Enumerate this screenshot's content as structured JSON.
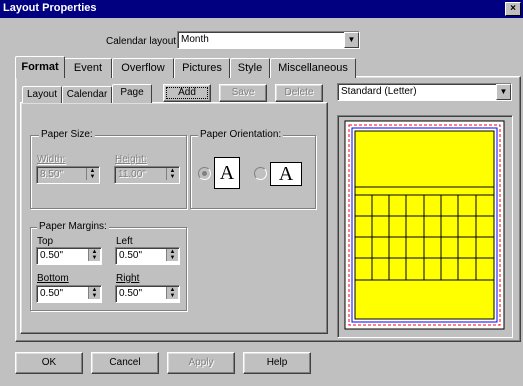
{
  "window": {
    "title": "Layout Properties",
    "close_glyph": "×"
  },
  "calendar_layout": {
    "label": "Calendar layout",
    "value": "Month"
  },
  "tabs": [
    "Format",
    "Event",
    "Overflow",
    "Pictures",
    "Style",
    "Miscellaneous"
  ],
  "subtabs": [
    "Layout",
    "Calendar",
    "Page"
  ],
  "toolbar": {
    "add": "Add",
    "save": "Save",
    "delete": "Delete"
  },
  "paper_select": {
    "value": "Standard (Letter)"
  },
  "paper_size": {
    "group": "Paper Size:",
    "width_label": "Width:",
    "width_value": "8.50\"",
    "height_label": "Height:",
    "height_value": "11.00\""
  },
  "orientation": {
    "group": "Paper Orientation:",
    "portrait_glyph": "A",
    "landscape_glyph": "A"
  },
  "margins": {
    "group": "Paper Margins:",
    "top_label": "Top",
    "top_value": "0.50\"",
    "left_label": "Left",
    "left_value": "0.50\"",
    "bottom_label": "Bottom",
    "bottom_value": "0.50\"",
    "right_label": "Right",
    "right_value": "0.50\""
  },
  "buttons": {
    "ok": "OK",
    "cancel": "Cancel",
    "apply": "Apply",
    "help": "Help"
  },
  "colors": {
    "preview_fill": "#ffff00",
    "margin_red": "#ff0000",
    "margin_blue": "#0000ff"
  }
}
